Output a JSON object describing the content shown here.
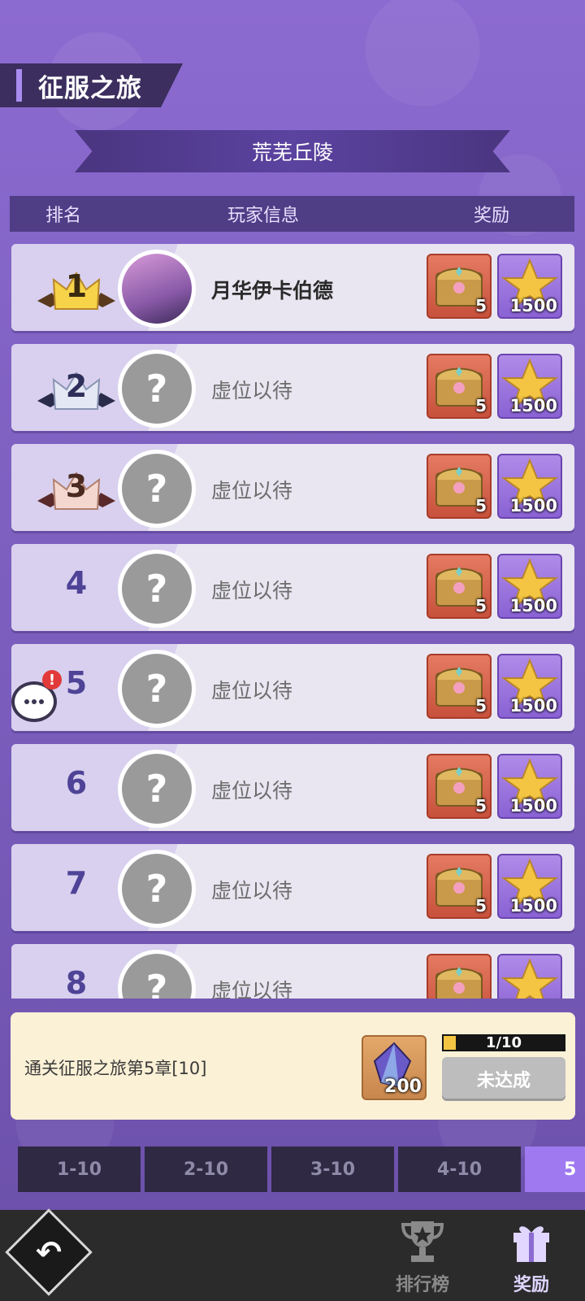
{
  "title": "征服之旅",
  "stage": "荒芜丘陵",
  "header": {
    "rank": "排名",
    "player": "玩家信息",
    "reward": "奖励"
  },
  "rows": [
    {
      "rank": "1",
      "name": "月华伊卡伯德",
      "chest_qty": "5",
      "gold_qty": "1500"
    },
    {
      "rank": "2",
      "name": "虚位以待",
      "chest_qty": "5",
      "gold_qty": "1500"
    },
    {
      "rank": "3",
      "name": "虚位以待",
      "chest_qty": "5",
      "gold_qty": "1500"
    },
    {
      "rank": "4",
      "name": "虚位以待",
      "chest_qty": "5",
      "gold_qty": "1500"
    },
    {
      "rank": "5",
      "name": "虚位以待",
      "chest_qty": "5",
      "gold_qty": "1500"
    },
    {
      "rank": "6",
      "name": "虚位以待",
      "chest_qty": "5",
      "gold_qty": "1500"
    },
    {
      "rank": "7",
      "name": "虚位以待",
      "chest_qty": "5",
      "gold_qty": "1500"
    },
    {
      "rank": "8",
      "name": "虚位以待",
      "chest_qty": "",
      "gold_qty": ""
    }
  ],
  "placeholder_avatar": "?",
  "chat_alert": "!",
  "task": {
    "text": "通关征服之旅第5章[10]",
    "reward_qty": "200",
    "progress_text": "1/10",
    "progress_fraction": 0.1,
    "status": "未达成"
  },
  "range_tabs": [
    "1-10",
    "2-10",
    "3-10",
    "4-10",
    "5"
  ],
  "nav": {
    "back_glyph": "↶",
    "ranking": "排行榜",
    "rewards": "奖励"
  },
  "colors": {
    "accent": "#9e79f0",
    "progress": "#f4c542",
    "chest": "#d4624b",
    "gold_tile": "#9c76de"
  }
}
